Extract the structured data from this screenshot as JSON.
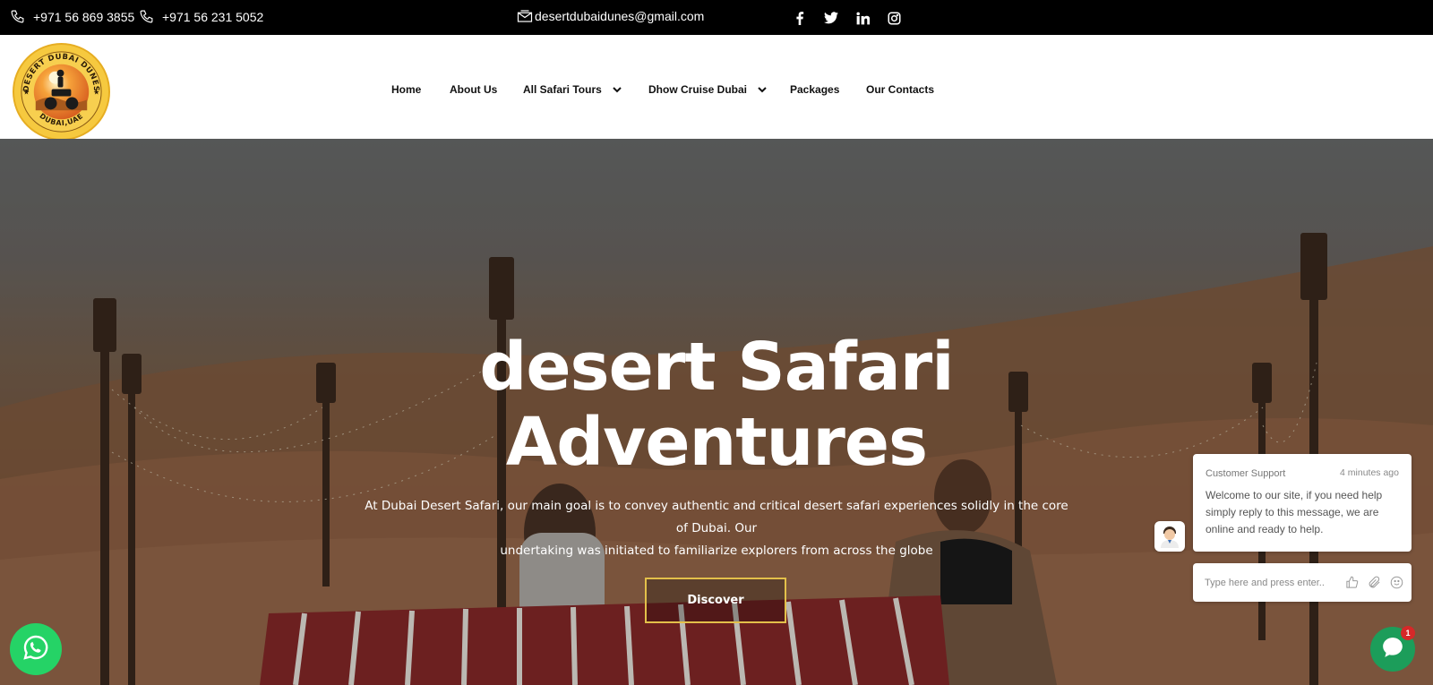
{
  "topbar": {
    "phone1": "+971 56 869 3855",
    "phone2": "+971 56 231 5052",
    "email": "desertdubaidunes@gmail.com",
    "social_icons": [
      "facebook-icon",
      "twitter-icon",
      "linkedin-icon",
      "instagram-icon"
    ]
  },
  "logo": {
    "top_text": "DESERT DUBAI DUNES",
    "bottom_text": "DUBAI,UAE"
  },
  "nav": {
    "items": [
      {
        "label": "Home"
      },
      {
        "label": "About Us"
      },
      {
        "label": "All Safari Tours",
        "dropdown": true
      },
      {
        "label": "Dhow Cruise Dubai",
        "dropdown": true
      },
      {
        "label": "Packages"
      },
      {
        "label": "Our Contacts"
      }
    ]
  },
  "hero": {
    "title_line1": "desert Safari",
    "title_line2": "Adventures",
    "description_line1": "At Dubai Desert Safari, our main goal is to convey authentic and critical desert safari experiences solidly in the core of Dubai. Our",
    "description_line2": "undertaking was initiated to familiarize explorers from across the globe",
    "cta": "Discover"
  },
  "chat": {
    "from": "Customer Support",
    "time": "4 minutes ago",
    "message": "Welcome to our site, if you need help simply reply to this message, we are online and ready to help.",
    "input_placeholder": "Type here and press enter..",
    "badge_count": "1"
  },
  "colors": {
    "topbar_bg": "#000000",
    "cta_border": "#e3c04a",
    "chat_launcher": "#1c9d5a",
    "whatsapp": "#25d366",
    "badge": "#d62828"
  }
}
